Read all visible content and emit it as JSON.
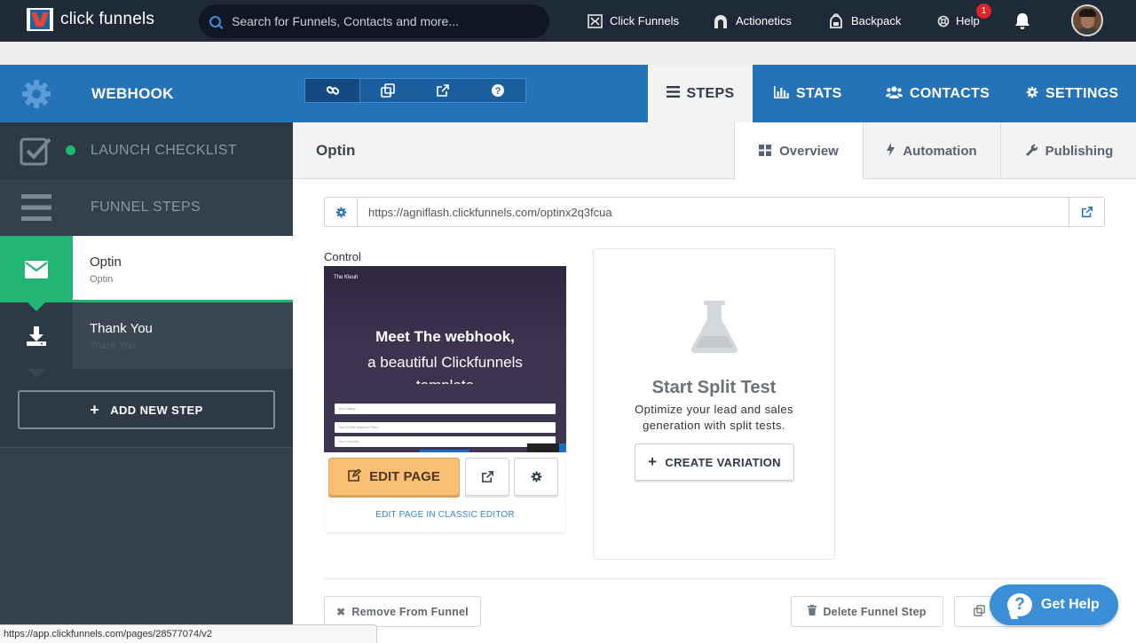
{
  "topnav": {
    "logo_text": "click funnels",
    "search_placeholder": "Search for Funnels, Contacts and more...",
    "links": [
      {
        "label": "Click Funnels",
        "icon": "clickfunnels-icon"
      },
      {
        "label": "Actionetics",
        "icon": "actionetics-icon"
      },
      {
        "label": "Backpack",
        "icon": "backpack-icon"
      },
      {
        "label": "Help",
        "icon": "help-icon"
      }
    ],
    "help_badge": "1"
  },
  "funnel": {
    "title": "WEBHOOK",
    "tabs": [
      {
        "label": "STEPS",
        "icon": "list-icon"
      },
      {
        "label": "STATS",
        "icon": "bar-chart-icon"
      },
      {
        "label": "CONTACTS",
        "icon": "users-icon"
      },
      {
        "label": "SETTINGS",
        "icon": "gear-icon"
      }
    ]
  },
  "sidebar": {
    "launch_checklist": "LAUNCH CHECKLIST",
    "funnel_steps": "FUNNEL STEPS",
    "steps": [
      {
        "name": "Optin",
        "sub": "Optin",
        "icon": "envelope-icon"
      },
      {
        "name": "Thank You",
        "sub": "Thank You",
        "icon": "download-icon"
      }
    ],
    "add_step": "ADD NEW STEP"
  },
  "step": {
    "title": "Optin",
    "tabs": [
      {
        "label": "Overview",
        "icon": "grid-icon"
      },
      {
        "label": "Automation",
        "icon": "bolt-icon"
      },
      {
        "label": "Publishing",
        "icon": "wrench-icon"
      }
    ],
    "url": "https://agniflash.clickfunnels.com/optinx2q3fcua",
    "control_label": "Control",
    "preview": {
      "brand": "The Kleuh",
      "headline": "Meet The webhook,",
      "subline1": "a beautiful Clickfunnels",
      "subline2": "template",
      "input1": "Your Name",
      "input2": "Your Email Address Here...",
      "input3": "Your Country"
    },
    "edit_page": "EDIT PAGE",
    "classic_editor": "EDIT PAGE IN CLASSIC EDITOR",
    "split_title": "Start Split Test",
    "split_desc": "Optimize your lead and sales generation with split tests.",
    "create_variation": "CREATE VARIATION",
    "remove_from_funnel": "Remove From Funnel",
    "delete_step": "Delete Funnel Step"
  },
  "help_widget": {
    "label": "Get Help"
  },
  "status_url": "https://app.clickfunnels.com/pages/28577074/v2",
  "colors": {
    "nav_dark": "#1e2a38",
    "header_blue": "#2473b9",
    "sidebar": "#33404d",
    "active_green": "#22b573",
    "edit_orange": "#f9bf72"
  }
}
